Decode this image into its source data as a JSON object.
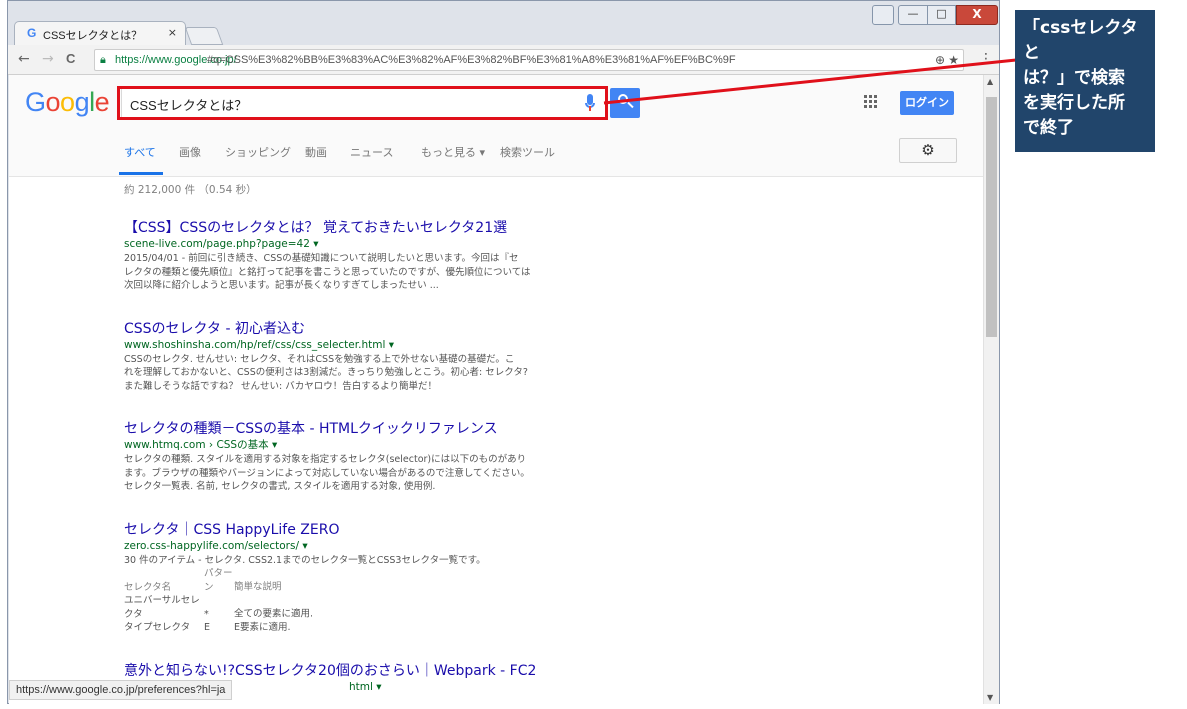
{
  "browser": {
    "tab_favicon": "G",
    "tab_title": "CSSセレクタとは？",
    "tab_close": "×",
    "window_controls": {
      "minimize": "—",
      "maximize": "□",
      "close": "X"
    },
    "nav": {
      "back": "←",
      "forward": "→",
      "reload": "C"
    },
    "url_secure": "https://www.google.co.jp/",
    "url_rest": "#q=CSS%E3%82%BB%E3%83%AC%E3%82%AF%E3%82%BF%E3%81%A8%E3%81%AF%EF%BC%9F",
    "menu": "⋮"
  },
  "google": {
    "logo": [
      "G",
      "o",
      "o",
      "g",
      "l",
      "e"
    ],
    "query": "CSSセレクタとは？",
    "login_label": "ログイン",
    "tabs": [
      "すべて",
      "画像",
      "ショッピング",
      "動画",
      "ニュース",
      "もっと見る ▾",
      "検索ツール"
    ],
    "settings_icon": "gear-icon",
    "stats": "約 212,000 件 （0.54 秒）",
    "results": [
      {
        "title": "【CSS】CSSのセレクタとは？ 覚えておきたいセレクタ21選",
        "url": "scene-live.com/page.php?page=42 ▾",
        "snippet": "2015/04/01 - 前回に引き続き、CSSの基礎知識について説明したいと思います。今回は『セ\nレクタの種類と優先順位』と銘打って記事を書こうと思っていたのですが、優先順位については\n次回以降に紹介しようと思います。記事が長くなりすぎてしまったせい ..."
      },
      {
        "title": "CSSのセレクタ - 初心者込む",
        "url": "www.shoshinsha.com/hp/ref/css/css_selecter.html ▾",
        "snippet": "CSSのセレクタ. せんせい: セレクタ、それはCSSを勉強する上で外せない基礎の基礎だ。こ\nれを理解しておかないと、CSSの便利さは3割減だ。きっちり勉強しとこう。初心者: セレクタ?\nまた難しそうな話ですね？ せんせい: バカヤロウ！告白するより簡単だ！"
      },
      {
        "title": "セレクタの種類－CSSの基本 - HTMLクイックリファレンス",
        "url": "www.htmq.com › CSSの基本 ▾",
        "snippet": "セレクタの種類. スタイルを適用する対象を指定するセレクタ(selector)には以下のものがあり\nます。ブラウザの種類やバージョンによって対応していない場合があるので注意してください。\nセレクタ一覧表. 名前, セレクタの書式, スタイルを適用する対象, 使用例."
      },
      {
        "title": "セレクタ｜CSS HappyLife ZERO",
        "url": "zero.css-happylife.com/selectors/ ▾",
        "snippet": "30 件のアイテム - セレクタ. CSS2.1までのセレクタ一覧とCSS3セレクタ一覧です。",
        "table": {
          "head": [
            "セレクタ名",
            "パターン",
            "簡単な説明"
          ],
          "rows": [
            [
              "ユニバーサルセレクタ",
              "*",
              "全ての要素に適用."
            ],
            [
              "タイプセレクタ",
              "E",
              "E要素に適用."
            ]
          ]
        }
      },
      {
        "title": "意外と知らない!?CSSセレクタ20個のおさらい｜Webpark - FC2",
        "url": "html ▾",
        "snippet": ""
      }
    ],
    "status_url": "https://www.google.co.jp/preferences?hl=ja"
  },
  "annotation": {
    "text": "「cssセレクタと\nは？」で検索\nを実行した所\nで終了",
    "bg_color": "#21456b",
    "highlight_color": "#e0101a"
  }
}
